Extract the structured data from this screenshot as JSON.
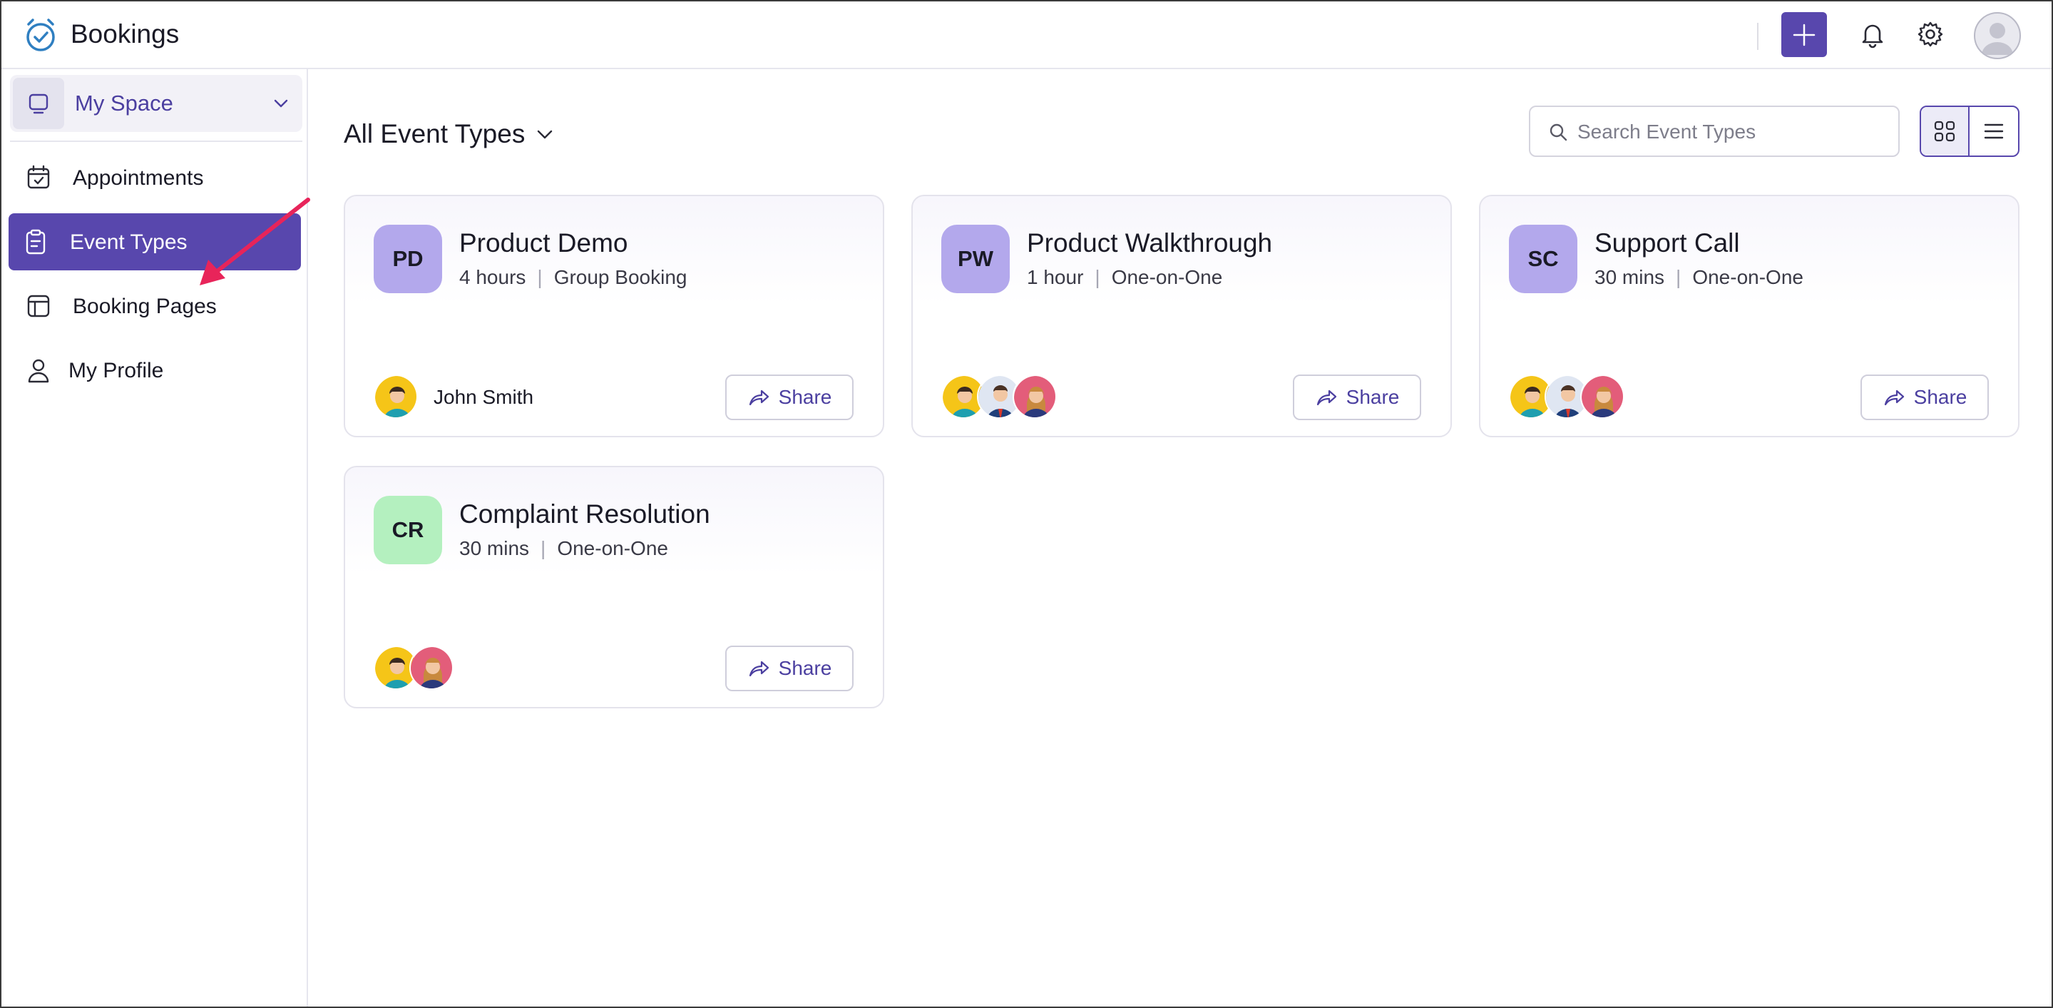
{
  "app": {
    "title": "Bookings"
  },
  "header": {
    "add_icon": "plus-icon",
    "notification_icon": "bell-icon",
    "settings_icon": "gear-icon",
    "profile_icon": "user-avatar"
  },
  "sidebar": {
    "workspace": {
      "label": "My Space"
    },
    "items": [
      {
        "label": "Appointments",
        "icon": "calendar-check-icon",
        "active": false
      },
      {
        "label": "Event Types",
        "icon": "clipboard-icon",
        "active": true
      },
      {
        "label": "Booking Pages",
        "icon": "layout-icon",
        "active": false
      },
      {
        "label": "My Profile",
        "icon": "person-icon",
        "active": false
      }
    ]
  },
  "main": {
    "filter_title": "All Event Types",
    "search": {
      "placeholder": "Search Event Types",
      "value": ""
    },
    "view_mode": "grid"
  },
  "cards": [
    {
      "initials": "PD",
      "title": "Product Demo",
      "duration": "4 hours",
      "type": "Group Booking",
      "owner": "John Smith",
      "share_label": "Share",
      "badge_color": "#b3a8ec"
    },
    {
      "initials": "PW",
      "title": "Product Walkthrough",
      "duration": "1 hour",
      "type": "One-on-One",
      "owner": "",
      "share_label": "Share",
      "badge_color": "#b3a8ec"
    },
    {
      "initials": "SC",
      "title": "Support Call",
      "duration": "30 mins",
      "type": "One-on-One",
      "owner": "",
      "share_label": "Share",
      "badge_color": "#b3a8ec"
    },
    {
      "initials": "CR",
      "title": "Complaint Resolution",
      "duration": "30 mins",
      "type": "One-on-One",
      "owner": "",
      "share_label": "Share",
      "badge_color": "#b4f0bf"
    }
  ],
  "colors": {
    "accent": "#5847ad",
    "annotation_arrow": "#e8245a"
  }
}
